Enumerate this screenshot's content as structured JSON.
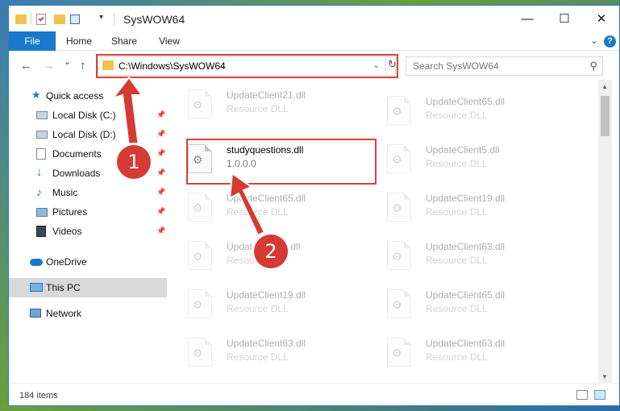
{
  "window": {
    "title": "SysWOW64",
    "minimize_glyph": "—",
    "maximize_glyph": "☐",
    "close_glyph": "✕"
  },
  "ribbon": {
    "tabs": [
      "File",
      "Home",
      "Share",
      "View"
    ],
    "help_glyph": "?",
    "collapse_glyph": "⌄"
  },
  "nav": {
    "back_glyph": "←",
    "forward_glyph": "→",
    "recent_glyph": "⌄",
    "up_glyph": "↑",
    "address": "C:\\Windows\\SysWOW64",
    "address_dropdown_glyph": "⌄",
    "refresh_glyph": "↻",
    "search_placeholder": "Search SysWOW64",
    "search_glyph": "⚲"
  },
  "sidebar": {
    "items": [
      {
        "label": "Quick access",
        "icon": "star-icon",
        "pinned": false
      },
      {
        "label": "Local Disk (C:)",
        "icon": "drive-icon",
        "pinned": true
      },
      {
        "label": "Local Disk (D:)",
        "icon": "drive-icon",
        "pinned": true
      },
      {
        "label": "Documents",
        "icon": "documents-icon",
        "pinned": true
      },
      {
        "label": "Downloads",
        "icon": "downloads-icon",
        "pinned": true
      },
      {
        "label": "Music",
        "icon": "music-icon",
        "pinned": true
      },
      {
        "label": "Pictures",
        "icon": "pictures-icon",
        "pinned": true
      },
      {
        "label": "Videos",
        "icon": "videos-icon",
        "pinned": true
      },
      {
        "label": "OneDrive",
        "icon": "onedrive-icon",
        "pinned": false
      },
      {
        "label": "This PC",
        "icon": "computer-icon",
        "pinned": false,
        "selected": true
      },
      {
        "label": "Network",
        "icon": "network-icon",
        "pinned": false
      }
    ],
    "pin_glyph": "📌"
  },
  "files": {
    "col1": [
      {
        "name": "UpdateClient21.dll",
        "desc": "Resource DLL"
      },
      {
        "name": "studyquestions.dll",
        "desc": "1.0.0.0",
        "highlight": true
      },
      {
        "name": "UpdateClient65.dll",
        "desc": "Resource DLL"
      },
      {
        "name": "UpdateClient5.dll",
        "desc": "Resource DLL"
      },
      {
        "name": "UpdateClient19.dll",
        "desc": "Resource DLL"
      },
      {
        "name": "UpdateClient63.dll",
        "desc": "Resource DLL"
      }
    ],
    "col2": [
      {
        "name": "UpdateClient65.dll",
        "desc": "Resource DLL"
      },
      {
        "name": "UpdateClient5.dll",
        "desc": "Resource DLL"
      },
      {
        "name": "UpdateClient19.dll",
        "desc": "Resource DLL"
      },
      {
        "name": "UpdateClient63.dll",
        "desc": "Resource DLL"
      },
      {
        "name": "UpdateClient65.dll",
        "desc": "Resource DLL"
      },
      {
        "name": "UpdateClient63.dll",
        "desc": "Resource DLL"
      }
    ],
    "gear_glyph": "⚙"
  },
  "status": {
    "item_count": "184 items"
  },
  "annotations": {
    "step1": "1",
    "step2": "2",
    "color": "#d53a33"
  },
  "colors": {
    "accent": "#1979ca",
    "highlight_box": "#d9403a"
  }
}
